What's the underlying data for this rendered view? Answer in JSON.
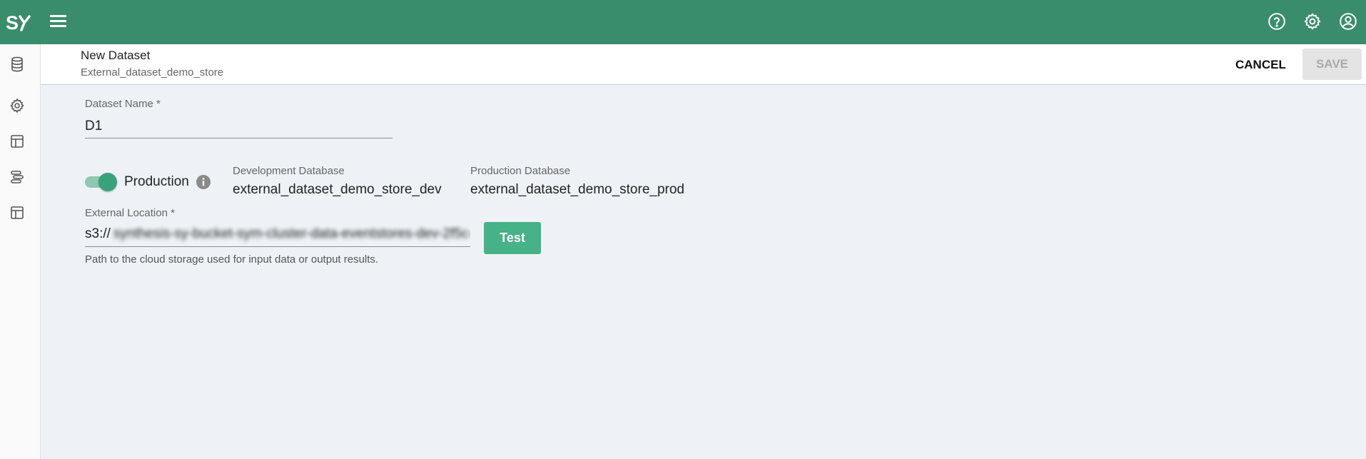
{
  "app": {
    "colors": {
      "header": "#3a8d6c",
      "accent": "#45b287",
      "background": "#eef2f6"
    }
  },
  "topbar": {
    "logo_icon": "sy-logo",
    "menu_icon": "hamburger-menu-icon",
    "icons": [
      "help-icon",
      "gear-icon",
      "account-icon"
    ]
  },
  "sidebar": {
    "icons": [
      "database-icon",
      "gear-icon",
      "table-layout-icon",
      "stack-list-icon",
      "table-layout-icon"
    ]
  },
  "header": {
    "title": "New Dataset",
    "subtitle": "External_dataset_demo_store",
    "cancel_label": "CANCEL",
    "save_label": "SAVE"
  },
  "form": {
    "dataset_name": {
      "label": "Dataset Name *",
      "value": "D1"
    },
    "production_toggle": {
      "label": "Production",
      "on": true
    },
    "development_database": {
      "label": "Development Database",
      "value": "external_dataset_demo_store_dev"
    },
    "production_database": {
      "label": "Production Database",
      "value": "external_dataset_demo_store_prod"
    },
    "external_location": {
      "label": "External Location *",
      "value_prefix": "s3://",
      "helper": "Path to the cloud storage used for input data or output results."
    },
    "test_label": "Test"
  }
}
